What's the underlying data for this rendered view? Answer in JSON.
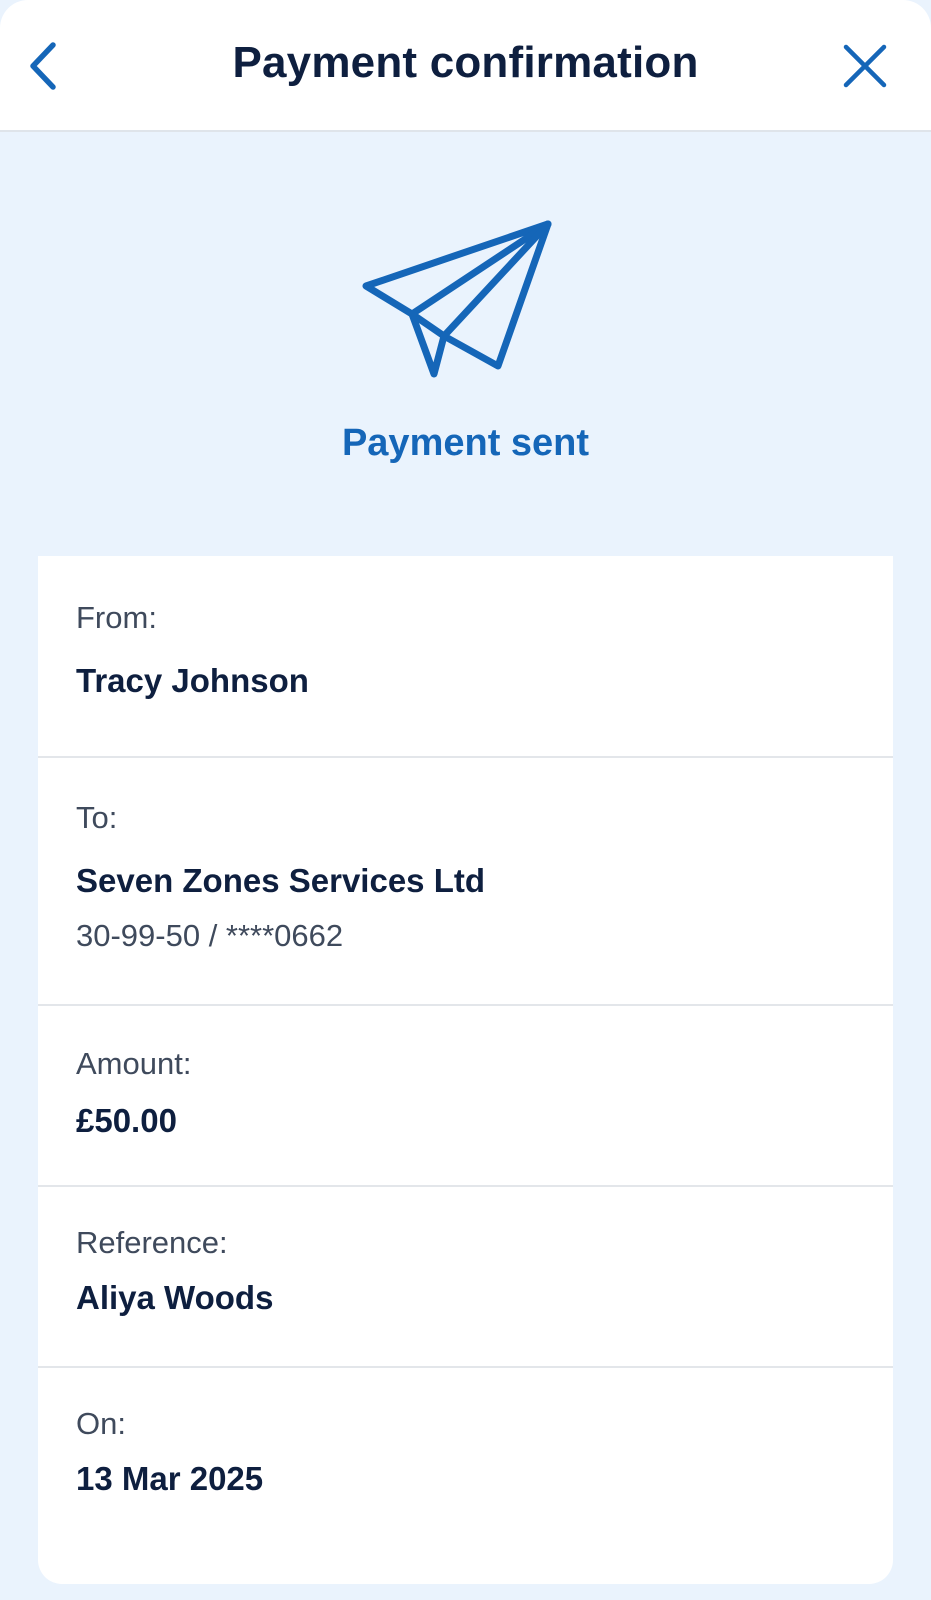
{
  "header": {
    "title": "Payment confirmation",
    "back_icon": "chevron-left-icon",
    "close_icon": "close-icon"
  },
  "status": {
    "icon": "paper-plane-icon",
    "text": "Payment sent"
  },
  "details": {
    "from": {
      "label": "From:",
      "value": "Tracy Johnson"
    },
    "to": {
      "label": "To:",
      "value": "Seven Zones Services Ltd",
      "account": "30-99-50 / ****0662"
    },
    "amount": {
      "label": "Amount:",
      "value": "£50.00"
    },
    "reference": {
      "label": "Reference:",
      "value": "Aliya Woods"
    },
    "date": {
      "label": "On:",
      "value": "13 Mar 2025"
    }
  },
  "colors": {
    "accent": "#1566b8",
    "background": "#eaf3fd",
    "text_primary": "#0e1f3f",
    "text_secondary": "#3f4a5c"
  }
}
